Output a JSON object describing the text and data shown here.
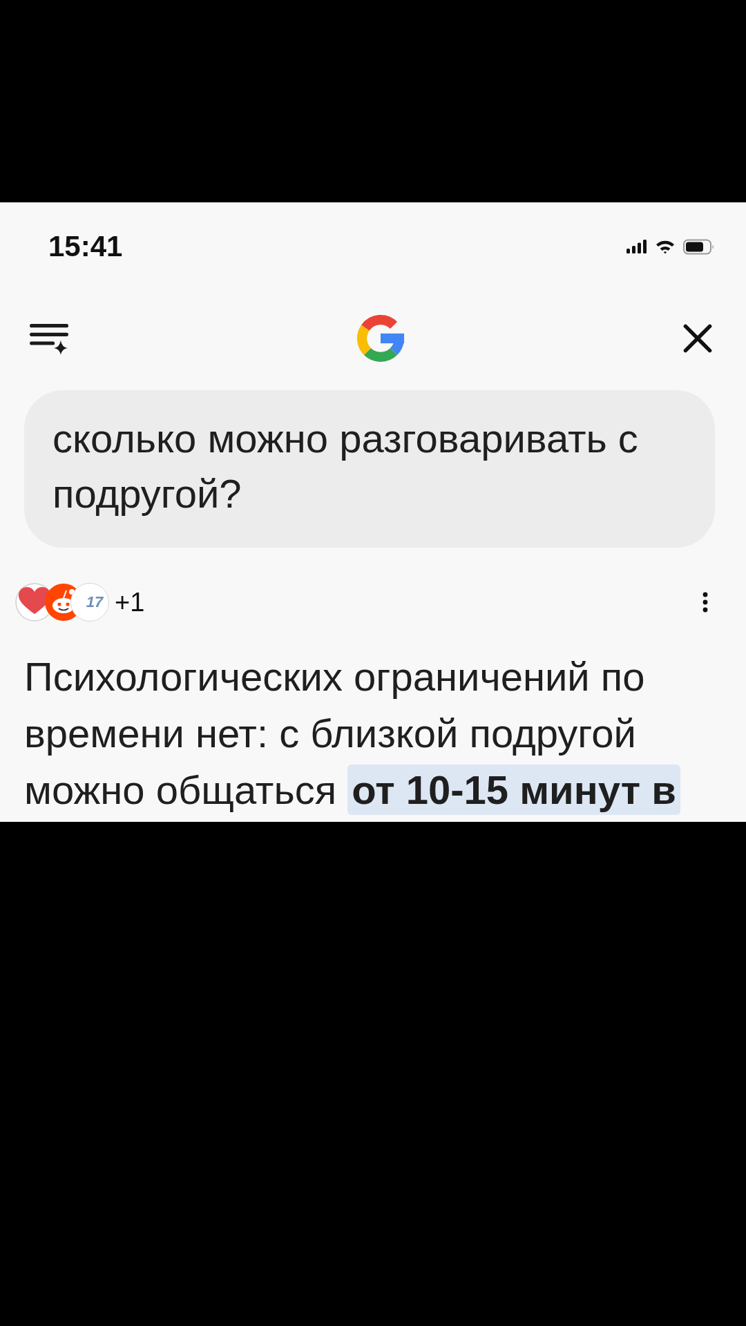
{
  "status_bar": {
    "time": "15:41"
  },
  "query": {
    "text": "сколько можно разговаривать с подругой?"
  },
  "answer": {
    "sources": [
      {
        "kind": "heart"
      },
      {
        "kind": "mascot"
      },
      {
        "kind": "logo",
        "label": "17"
      }
    ],
    "more_count": "+1",
    "text": "Психологических ограничений по времени нет: с близкой подругой можно общаться **от 10-15 минут в**"
  }
}
